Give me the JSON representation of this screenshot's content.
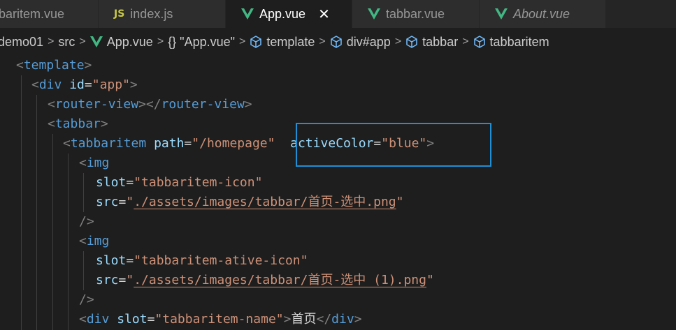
{
  "tabs": [
    {
      "label": "baritem.vue",
      "icon": "vue-icon",
      "active": false,
      "italic": false
    },
    {
      "label": "index.js",
      "icon": "js-icon",
      "icon_text": "JS",
      "active": false,
      "italic": false
    },
    {
      "label": "App.vue",
      "icon": "vue-icon",
      "active": true,
      "italic": false,
      "close": "✕"
    },
    {
      "label": "tabbar.vue",
      "icon": "vue-icon",
      "active": false,
      "italic": false
    },
    {
      "label": "About.vue",
      "icon": "vue-icon",
      "active": false,
      "italic": true
    }
  ],
  "breadcrumb": {
    "items": [
      "demo01",
      "src",
      "App.vue",
      "{} \"App.vue\"",
      "template",
      "div#app",
      "tabbar",
      "tabbaritem"
    ],
    "separator": ">"
  },
  "code": {
    "l1": {
      "open": "<",
      "tag": "template",
      "close": ">"
    },
    "l2": {
      "open": "<",
      "tag": "div",
      "attr": "id",
      "eq": "=",
      "val": "\"app\"",
      "close": ">"
    },
    "l3": {
      "open": "<",
      "tag": "router-view",
      "mid": "></",
      "tag2": "router-view",
      "close": ">"
    },
    "l4": {
      "open": "<",
      "tag": "tabbar",
      "close": ">"
    },
    "l5": {
      "open": "<",
      "tag": "tabbaritem",
      "attr": "path",
      "eq": "=",
      "val": "\"/homepage\"",
      "attr2": "activeColor",
      "eq2": "=",
      "val2": "\"blue\"",
      "close": ">"
    },
    "l6": {
      "open": "<",
      "tag": "img"
    },
    "l7": {
      "attr": "slot",
      "eq": "=",
      "val": "\"tabbaritem-icon\""
    },
    "l8": {
      "attr": "src",
      "eq": "=",
      "q1": "\"",
      "path": "./assets/images/tabbar/首页-选中.png",
      "q2": "\""
    },
    "l9": {
      "close": "/>"
    },
    "l10": {
      "open": "<",
      "tag": "img"
    },
    "l11": {
      "attr": "slot",
      "eq": "=",
      "val": "\"tabbaritem-ative-icon\""
    },
    "l12": {
      "attr": "src",
      "eq": "=",
      "q1": "\"",
      "path": "./assets/images/tabbar/首页-选中 (1).png",
      "q2": "\""
    },
    "l13": {
      "close": "/>"
    },
    "l14": {
      "open": "<",
      "tag": "div",
      "attr": "slot",
      "eq": "=",
      "val": "\"tabbaritem-name\"",
      "gt": ">",
      "text": "首页",
      "endopen": "</",
      "tag2": "div",
      "close": ">"
    }
  },
  "colors": {
    "vue_green": "#41b883",
    "js_yellow": "#cbcb41",
    "highlight_border": "#1f8fd6",
    "cube_blue": "#75beff"
  }
}
